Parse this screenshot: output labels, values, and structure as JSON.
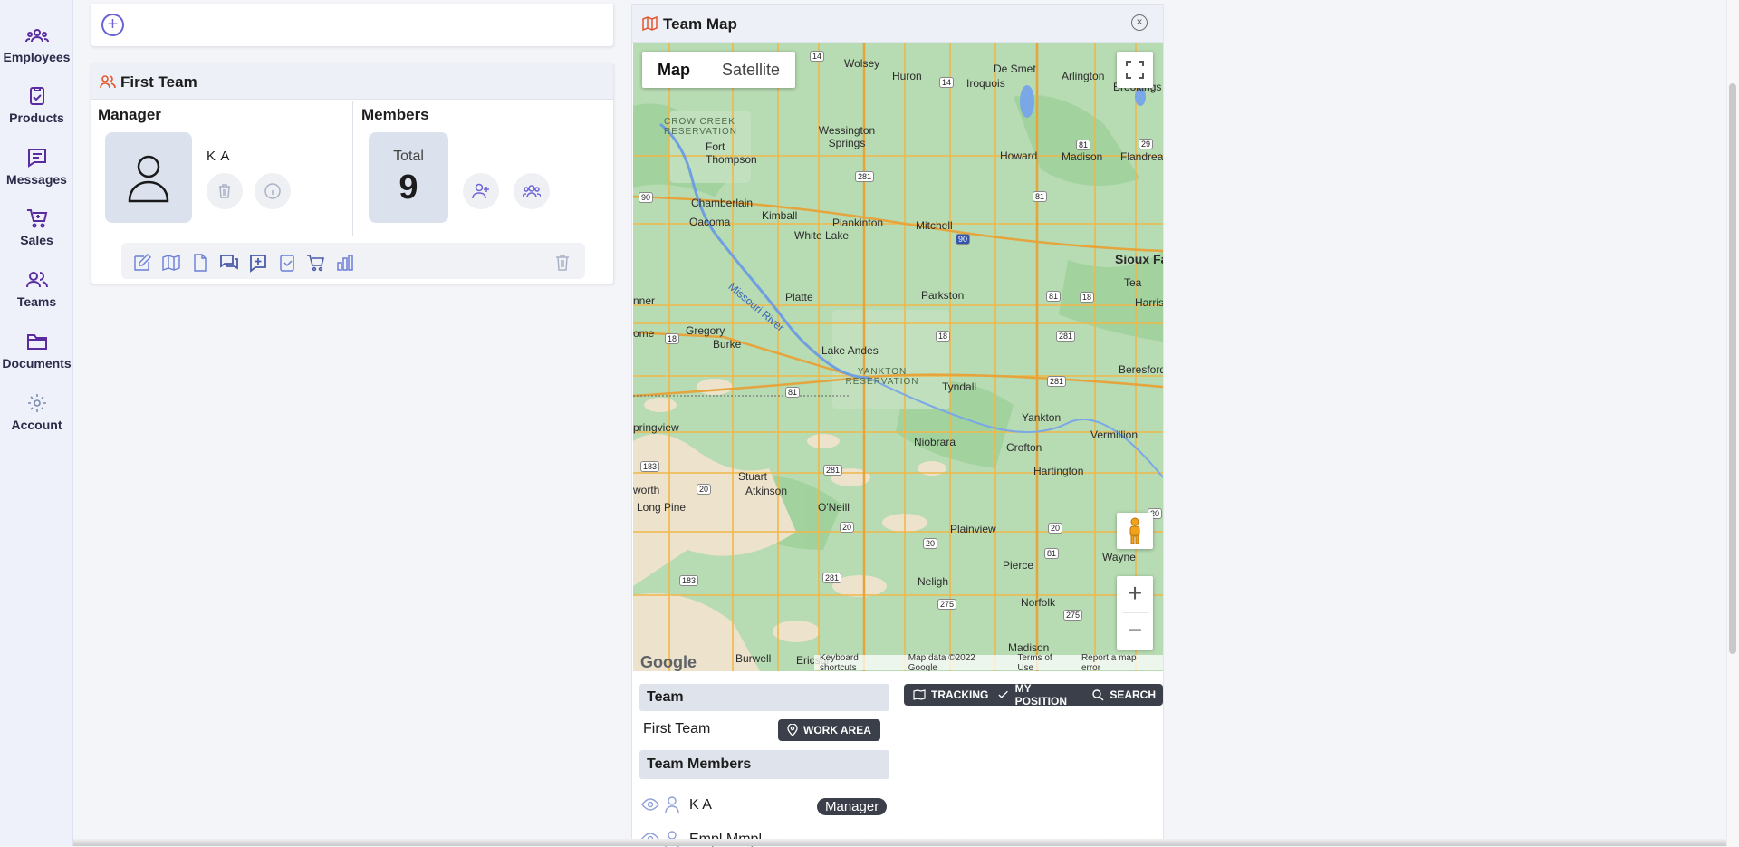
{
  "sidebar": {
    "items": [
      {
        "label": "Employees"
      },
      {
        "label": "Products"
      },
      {
        "label": "Messages"
      },
      {
        "label": "Sales"
      },
      {
        "label": "Teams"
      },
      {
        "label": "Documents"
      },
      {
        "label": "Account"
      }
    ]
  },
  "add": {
    "symbol": "+"
  },
  "team_card": {
    "title": "First Team",
    "manager_label": "Manager",
    "manager_name": "K A",
    "members_label": "Members",
    "total_label": "Total",
    "total_value": "9"
  },
  "map_panel": {
    "title": "Team Map",
    "close_symbol": "×",
    "map_type": {
      "map": "Map",
      "satellite": "Satellite"
    },
    "zoom_in": "+",
    "zoom_out": "−",
    "google_logo": "Google",
    "attribution": {
      "shortcuts": "Keyboard shortcuts",
      "data": "Map data ©2022 Google",
      "terms": "Terms of Use",
      "report": "Report a map error"
    },
    "places": {
      "wolsey": "Wolsey",
      "huron": "Huron",
      "iroquois": "Iroquois",
      "desmet": "De Smet",
      "arlington": "Arlington",
      "brookings": "Brookings",
      "wessington": "Wessington Springs",
      "howard": "Howard",
      "madison": "Madison",
      "flandreau": "Flandreau",
      "fort_thompson": "Fort Thompson",
      "chamberlain": "Chamberlain",
      "oacoma": "Oacoma",
      "kimball": "Kimball",
      "plankinton": "Plankinton",
      "white_lake": "White Lake",
      "mitchell": "Mitchell",
      "sioux_falls": "Sioux Fa",
      "tea": "Tea",
      "harrisburg": "Harrisb",
      "platte": "Platte",
      "parkston": "Parkston",
      "gregory": "Gregory",
      "burke": "Burke",
      "lake_andes": "Lake Andes",
      "tyndall": "Tyndall",
      "beresford": "Beresford",
      "yankton": "Yankton",
      "vermillion": "Vermillion",
      "niobrara": "Niobrara",
      "crofton": "Crofton",
      "springview": "pringview",
      "stuart": "Stuart",
      "atkinson": "Atkinson",
      "oneill": "O'Neill",
      "hartington": "Hartington",
      "long_pine": "Long Pine",
      "ainsworth": "worth",
      "plainview": "Plainview",
      "wayne": "Wayne",
      "pierce": "Pierce",
      "neligh": "Neligh",
      "norfolk": "Norfolk",
      "madison_ne": "Madison",
      "burwell": "Burwell",
      "ericson": "Ericson",
      "winner": "nner",
      "ome": "ome",
      "missouri": "Missouri River",
      "crow_creek": "CROW CREEK RESERVATION",
      "yankton_res": "YANKTON RESERVATION"
    },
    "shields": [
      "14",
      "14",
      "281",
      "81",
      "29",
      "90",
      "90",
      "81",
      "281",
      "81",
      "18",
      "18",
      "18",
      "81",
      "281",
      "183",
      "20",
      "281",
      "20",
      "20",
      "81",
      "20",
      "275",
      "275",
      "183",
      "281",
      "20"
    ],
    "team_section": "Team",
    "team_name": "First Team",
    "work_area": "WORK AREA",
    "tracking": "TRACKING",
    "my_position": "MY POSITION",
    "search": "SEARCH",
    "members_section": "Team Members",
    "members": [
      {
        "name": "K A",
        "role": "Manager"
      },
      {
        "name": "Empl Mmpl",
        "role": ""
      }
    ]
  }
}
